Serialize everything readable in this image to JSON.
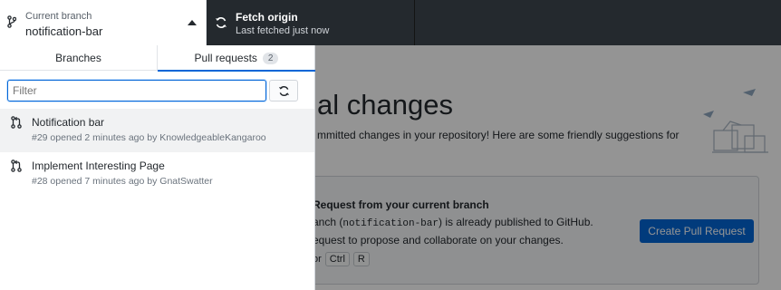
{
  "toolbar": {
    "branch_label": "Current branch",
    "branch_name": "notification-bar",
    "fetch_title": "Fetch origin",
    "fetch_subtitle": "Last fetched just now"
  },
  "foldout": {
    "tabs": [
      {
        "label": "Branches"
      },
      {
        "label": "Pull requests",
        "count": "2"
      }
    ],
    "filter_placeholder": "Filter",
    "pull_requests": [
      {
        "title": "Notification bar",
        "subtitle": "#29 opened 2 minutes ago by KnowledgeableKangaroo"
      },
      {
        "title": "Implement Interesting Page",
        "subtitle": "#28 opened 7 minutes ago by GnatSwatter"
      }
    ]
  },
  "main": {
    "heading": "al changes",
    "intro": "mmitted changes in your repository! Here are some friendly suggestions for",
    "card": {
      "title": "Request from your current branch",
      "line1_pre": "anch (",
      "line1_code": "notification-bar",
      "line1_post": ") is already published to GitHub.",
      "line2": "equest to propose and collaborate on your changes.",
      "keys_prefix": "or",
      "keys": [
        "Ctrl",
        "R"
      ],
      "button": "Create Pull Request"
    }
  },
  "colors": {
    "toolbar_bg": "#24292e",
    "accent": "#0366d6",
    "overlay": "rgba(0,0,0,0.42)"
  }
}
